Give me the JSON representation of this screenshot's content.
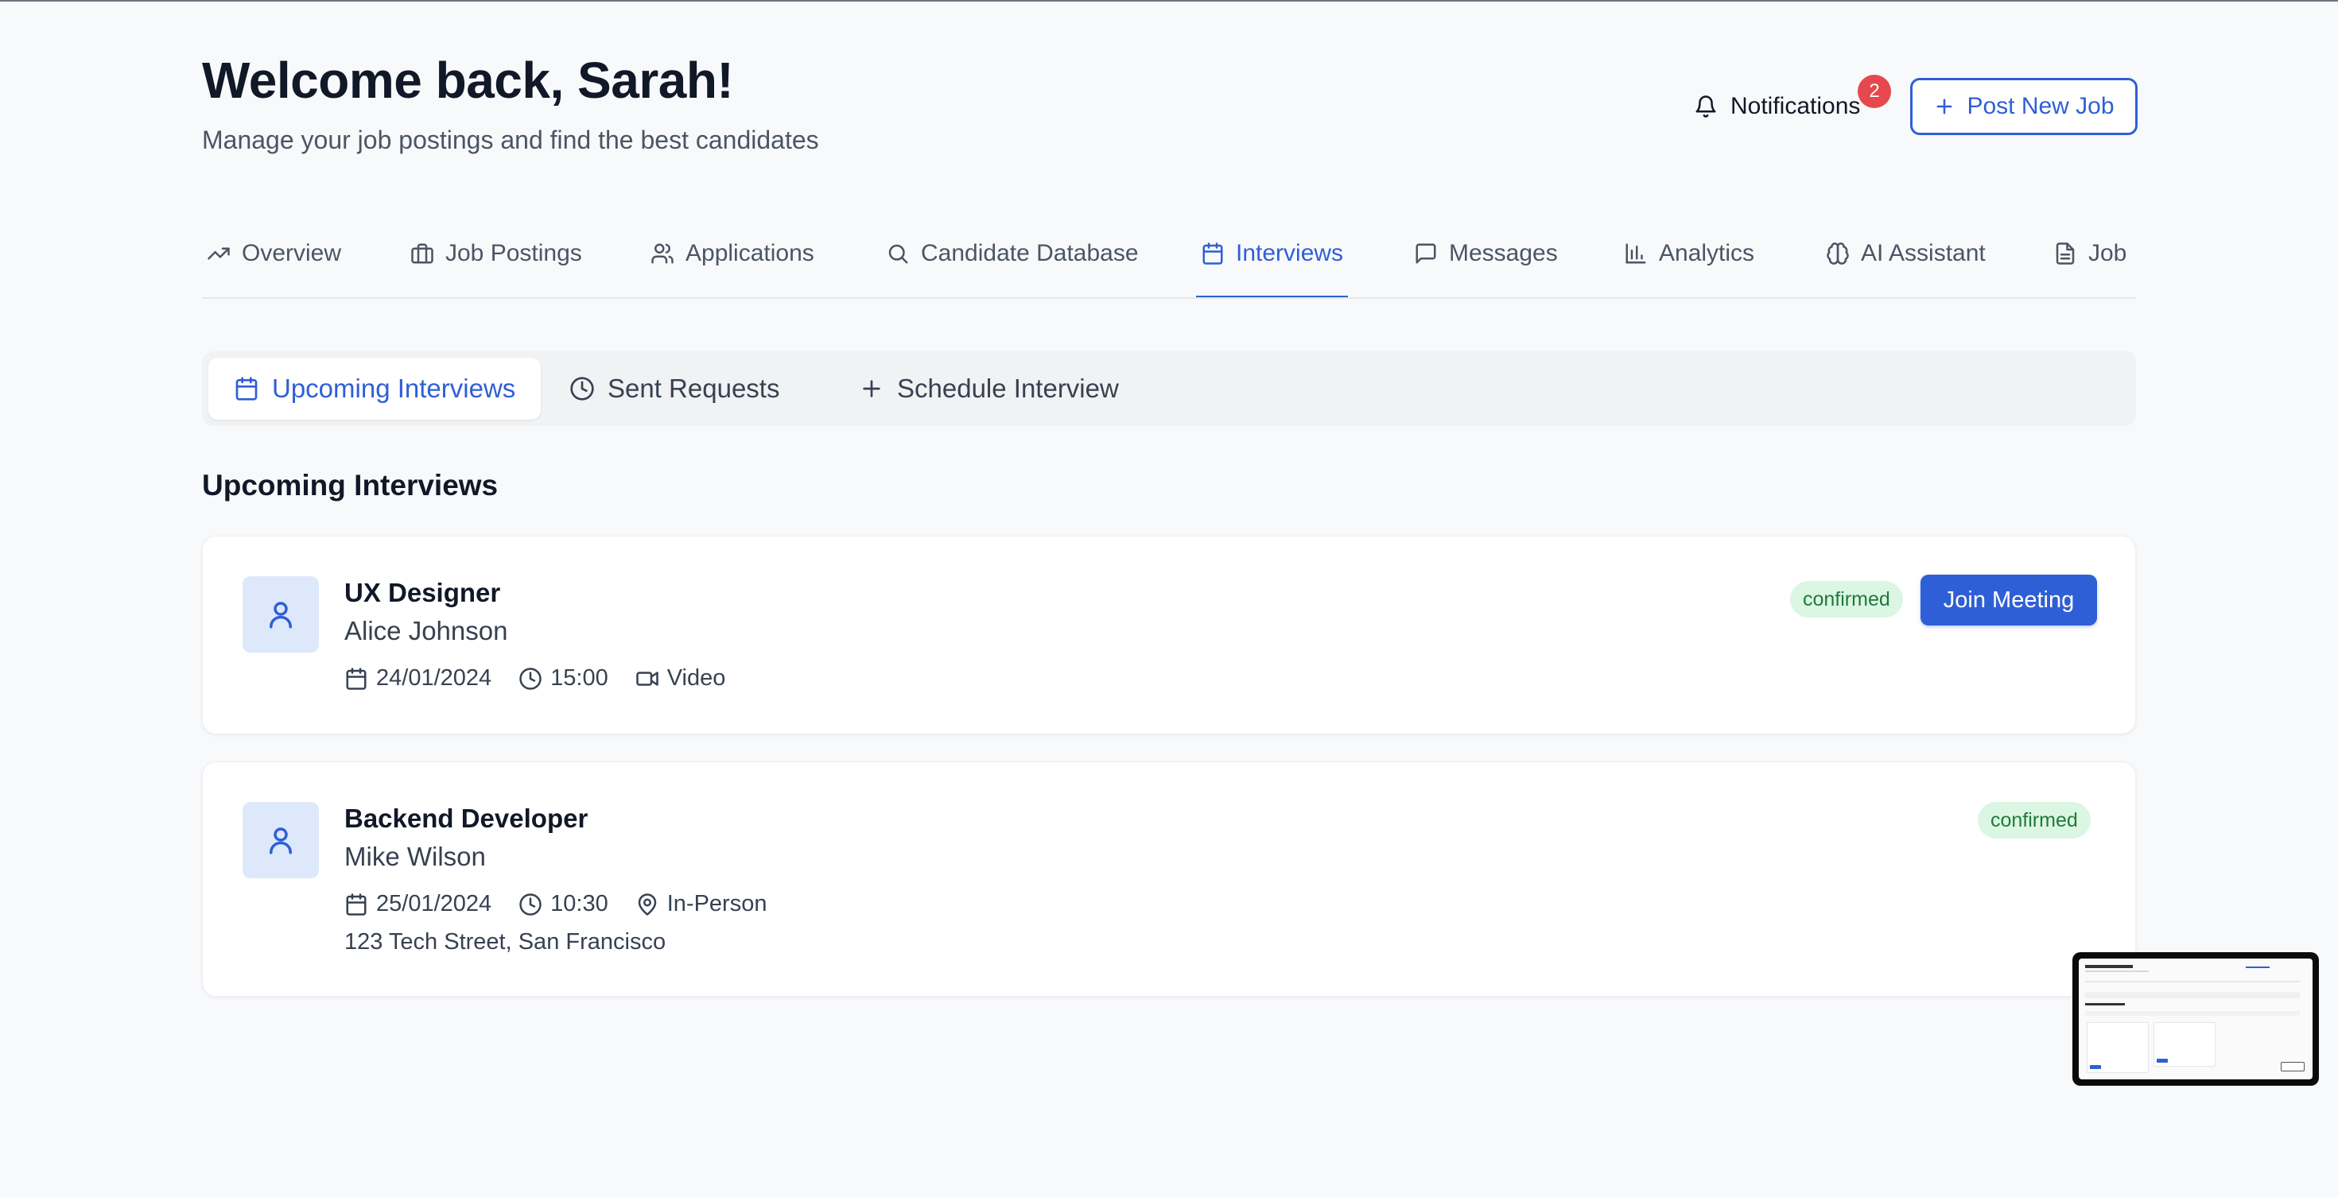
{
  "header": {
    "title": "Welcome back, Sarah!",
    "subtitle": "Manage your job postings and find the best candidates",
    "notifications_label": "Notifications",
    "notifications_count": "2",
    "post_job_label": "Post New Job"
  },
  "nav": {
    "tabs": [
      {
        "label": "Overview",
        "icon": "trending-up-icon"
      },
      {
        "label": "Job Postings",
        "icon": "briefcase-icon"
      },
      {
        "label": "Applications",
        "icon": "users-icon"
      },
      {
        "label": "Candidate Database",
        "icon": "search-icon"
      },
      {
        "label": "Interviews",
        "icon": "calendar-icon",
        "active": true
      },
      {
        "label": "Messages",
        "icon": "message-icon"
      },
      {
        "label": "Analytics",
        "icon": "bar-chart-icon"
      },
      {
        "label": "AI Assistant",
        "icon": "brain-icon"
      },
      {
        "label": "Job",
        "icon": "document-icon"
      }
    ]
  },
  "subtabs": [
    {
      "label": "Upcoming Interviews",
      "icon": "calendar-icon",
      "active": true
    },
    {
      "label": "Sent Requests",
      "icon": "clock-icon"
    },
    {
      "label": "Schedule Interview",
      "icon": "plus-icon"
    }
  ],
  "section": {
    "title": "Upcoming Interviews"
  },
  "interviews": [
    {
      "job_title": "UX Designer",
      "candidate": "Alice Johnson",
      "date": "24/01/2024",
      "time": "15:00",
      "mode": "Video",
      "status": "confirmed",
      "action_label": "Join Meeting"
    },
    {
      "job_title": "Backend Developer",
      "candidate": "Mike Wilson",
      "date": "25/01/2024",
      "time": "10:30",
      "mode": "In-Person",
      "address": "123 Tech Street, San Francisco",
      "status": "confirmed"
    }
  ],
  "colors": {
    "accent": "#2f5fd6",
    "badge_bg": "#dcf6e4",
    "badge_text": "#1f7a3a",
    "notification_badge": "#e5484d"
  }
}
